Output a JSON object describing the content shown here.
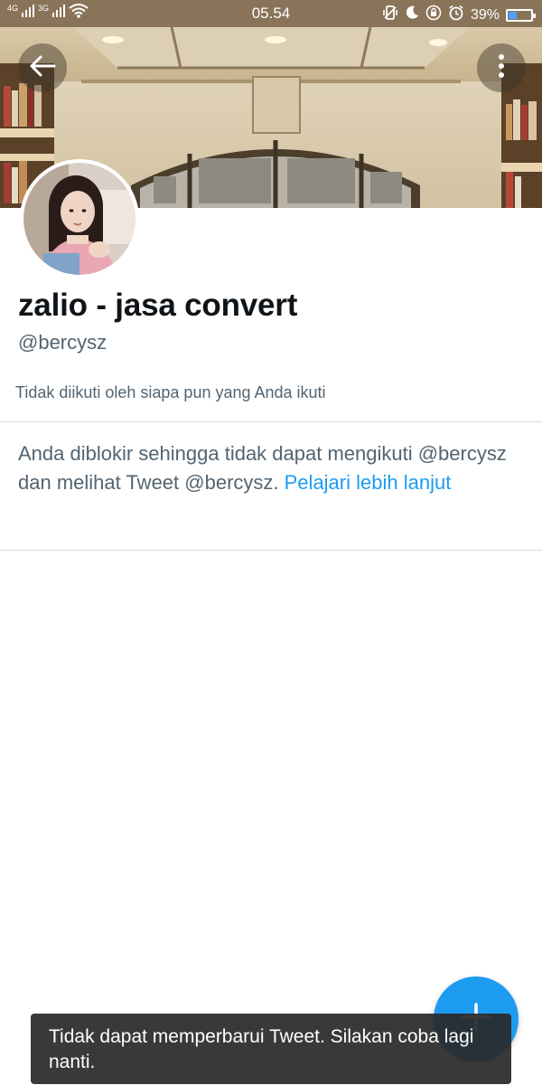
{
  "status_bar": {
    "network_label": "4G",
    "network_label_2": "3G",
    "time": "05.54",
    "battery_percent": "39%",
    "battery_level": 0.39,
    "icons": [
      "signal-icon",
      "wifi-icon",
      "vibrate-icon",
      "moon-icon",
      "rotation-lock-icon",
      "alarm-icon",
      "battery-icon"
    ]
  },
  "header": {
    "back_icon": "arrow-left-icon",
    "more_icon": "more-vertical-icon"
  },
  "profile": {
    "display_name": "zalio - jasa convert",
    "handle": "@bercysz",
    "followers_note": "Tidak diikuti oleh siapa pun yang Anda ikuti"
  },
  "blocked_notice": {
    "text": "Anda diblokir sehingga tidak dapat mengikuti @bercysz dan melihat Tweet @bercysz.",
    "link_label": "Pelajari lebih lanjut"
  },
  "fab": {
    "icon": "plus-icon"
  },
  "toast": {
    "message": "Tidak dapat memperbarui Tweet. Silakan coba lagi nanti."
  },
  "colors": {
    "accent": "#1d9bf0",
    "secondary_text": "#536471",
    "status_bar": "#8a7459"
  }
}
